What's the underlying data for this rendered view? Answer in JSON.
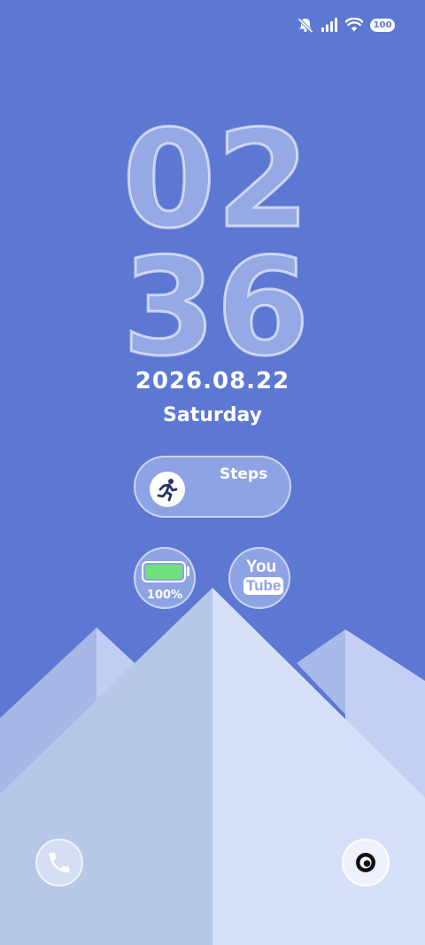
{
  "status_bar": {
    "battery_level": "100",
    "icons": [
      "mute-icon",
      "signal-icon",
      "wifi-icon",
      "battery-icon"
    ]
  },
  "clock": {
    "hour_tens": "0",
    "hour_ones": "2",
    "minute_tens": "3",
    "minute_ones": "6"
  },
  "date": "2026.08.22",
  "weekday": "Saturday",
  "widgets": {
    "steps": {
      "label": "Steps",
      "icon": "running-person-icon"
    },
    "battery": {
      "percent": "100%",
      "level": 1.0,
      "fill_color": "#6ee07c"
    },
    "youtube": {
      "top": "You",
      "bottom": "Tube"
    }
  },
  "shortcuts": {
    "left": "phone-icon",
    "right": "camera-icon"
  },
  "colors": {
    "background": "#5c78d3",
    "mountain_left": "#b7c7e8",
    "mountain_right": "#d6e0f8"
  }
}
